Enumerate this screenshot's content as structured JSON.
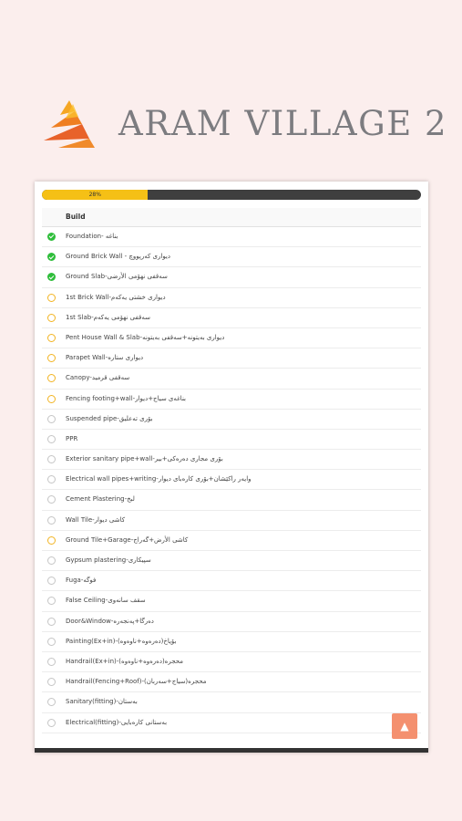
{
  "header": {
    "title": "ARAM VILLAGE 2"
  },
  "progress": {
    "label": "28%",
    "value": 0.28
  },
  "table": {
    "header": "Build"
  },
  "colors": {
    "done": "#2ebd3a",
    "in_progress": "#f2b423",
    "todo": "#c5c5c5",
    "accent": "#f4906f"
  },
  "rows": [
    {
      "label": "Foundation- بناغە",
      "status": "done"
    },
    {
      "label": "Ground Brick Wall - دیواری کەرپووچ",
      "status": "done"
    },
    {
      "label": "Ground Slab-سەقفی نهۆمی الأرضی",
      "status": "done"
    },
    {
      "label": "1st Brick Wall-دیواری خشتی یەکەم",
      "status": "in_progress"
    },
    {
      "label": "1st Slab-سەقفی نهۆمی یەکەم",
      "status": "in_progress"
    },
    {
      "label": "Pent House Wall & Slab-دیواری بەیتونە+سەقفی بەیتونە",
      "status": "in_progress"
    },
    {
      "label": "Parapet Wall-دیواری ستارە",
      "status": "in_progress"
    },
    {
      "label": "Canopy-سەقفی قرمید",
      "status": "in_progress"
    },
    {
      "label": "Fencing footing+wall-بناغەی سیاج+دیوار",
      "status": "in_progress"
    },
    {
      "label": "Suspended pipe-بۆری تەعلیق",
      "status": "todo"
    },
    {
      "label": "PPR",
      "status": "todo"
    },
    {
      "label": "Exterior sanitary pipe+wall-بۆری مجاری دەرەکی+بیر",
      "status": "todo"
    },
    {
      "label": "Electrical wall pipes+writing-وایەر راکێشان+بۆری کارەبای دیوار",
      "status": "todo"
    },
    {
      "label": "Cement Plastering-لبخ",
      "status": "todo"
    },
    {
      "label": "Wall Tile-کاشی دیوار",
      "status": "todo"
    },
    {
      "label": "Ground Tile+Garage-کاشی الأرض+گەراج",
      "status": "in_progress"
    },
    {
      "label": "Gypsum plastering-سپیکاری",
      "status": "todo"
    },
    {
      "label": "Fuga-فوگە",
      "status": "todo"
    },
    {
      "label": "False Ceiling-سقف سانەوی",
      "status": "todo"
    },
    {
      "label": "Door&Window-دەرگا+پەنجەرە",
      "status": "todo"
    },
    {
      "label": "Painting(Ex+in)-بۆیاخ(دەرەوە+ناوەوە)",
      "status": "todo"
    },
    {
      "label": "Handrail(Ex+in)-محجرە(دەرەوە+ناوەوە)",
      "status": "todo"
    },
    {
      "label": "Handrail(Fencing+Roof)-محجرە(سیاج+سەربان)",
      "status": "todo"
    },
    {
      "label": "Sanitary(fitting)-بەستان",
      "status": "todo"
    },
    {
      "label": "Electrical(fitting)-بەستانی کارەبایی",
      "status": "todo"
    }
  ],
  "scroll_top": {
    "icon": "chevron-up-icon"
  }
}
